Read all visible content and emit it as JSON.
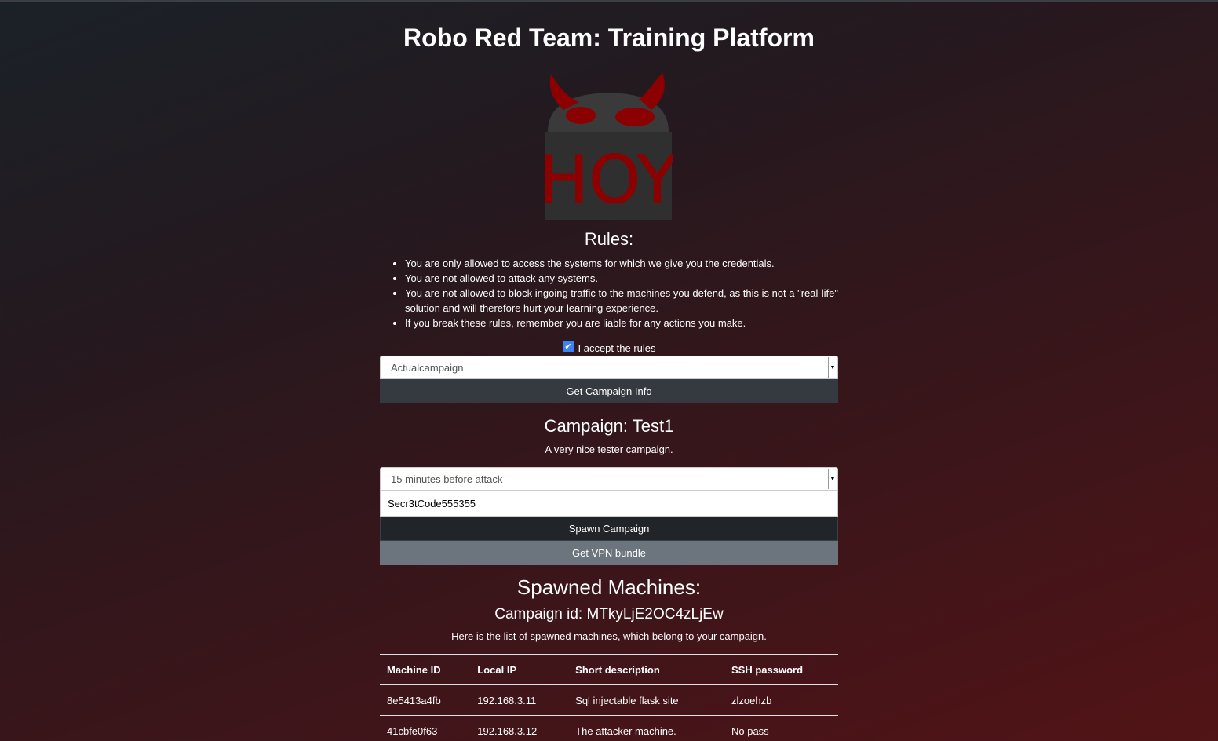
{
  "header": {
    "title": "Robo Red Team: Training Platform",
    "logo_text": "HOY"
  },
  "rules": {
    "title": "Rules:",
    "items": [
      "You are only allowed to access the systems for which we give you the credentials.",
      "You are not allowed to attack any systems.",
      "You are not allowed to block ingoing traffic to the machines you defend, as this is not a \"real-life\" solution and will therefore hurt your learning experience.",
      "If you break these rules, remember you are liable for any actions you make."
    ],
    "accept_label": "I accept the rules",
    "accept_checked": true
  },
  "campaign_select": {
    "value": "Actualcampaign",
    "button_label": "Get Campaign Info"
  },
  "campaign": {
    "title": "Campaign: Test1",
    "description": "A very nice tester campaign.",
    "timing_value": "15 minutes before attack",
    "code_value": "Secr3tCode555355",
    "spawn_label": "Spawn Campaign",
    "vpn_label": "Get VPN bundle"
  },
  "spawned": {
    "title": "Spawned Machines:",
    "campaign_id": "Campaign id: MTkyLjE2OC4zLjEw",
    "description": "Here is the list of spawned machines, which belong to your campaign.",
    "columns": [
      "Machine ID",
      "Local IP",
      "Short description",
      "SSH password"
    ],
    "rows": [
      [
        "8e5413a4fb",
        "192.168.3.11",
        "Sql injectable flask site",
        "zlzoehzb"
      ],
      [
        "41cbfe0f63",
        "192.168.3.12",
        "The attacker machine.",
        "No pass"
      ]
    ]
  },
  "colors": {
    "logo_gray": "#3a3a3a",
    "logo_red": "#8b0000",
    "button_dark": "#343a40",
    "button_gray": "#6c757d",
    "checkbox_blue": "#3b82f6"
  }
}
